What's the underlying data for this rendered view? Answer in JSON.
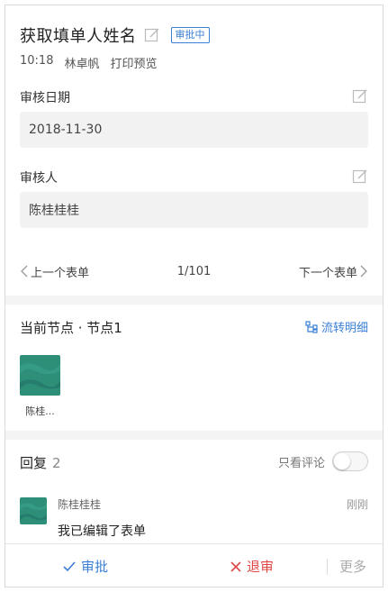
{
  "header": {
    "title": "获取填单人姓名",
    "status_badge": "审批中",
    "time": "10:18",
    "author": "林卓帆",
    "print_preview": "打印预览"
  },
  "fields": [
    {
      "label": "审核日期",
      "value": "2018-11-30"
    },
    {
      "label": "审核人",
      "value": "陈桂桂桂"
    }
  ],
  "pager": {
    "prev_label": "上一个表单",
    "position": "1/101",
    "next_label": "下一个表单"
  },
  "node_section": {
    "title": "当前节点 · 节点1",
    "flow_link": "流转明细",
    "node_user": "陈桂..."
  },
  "reply_section": {
    "title": "回复",
    "count": "2",
    "only_comments": "只看评论",
    "comment": {
      "user": "陈桂桂桂",
      "time": "刚刚",
      "text": "我已编辑了表单"
    }
  },
  "actions": {
    "approve": "审批",
    "reject": "退审",
    "more": "更多"
  },
  "colors": {
    "accent": "#3a7fd5",
    "danger": "#e04848",
    "field_bg": "#f2f2f2",
    "avatar": "#2e8f79"
  }
}
